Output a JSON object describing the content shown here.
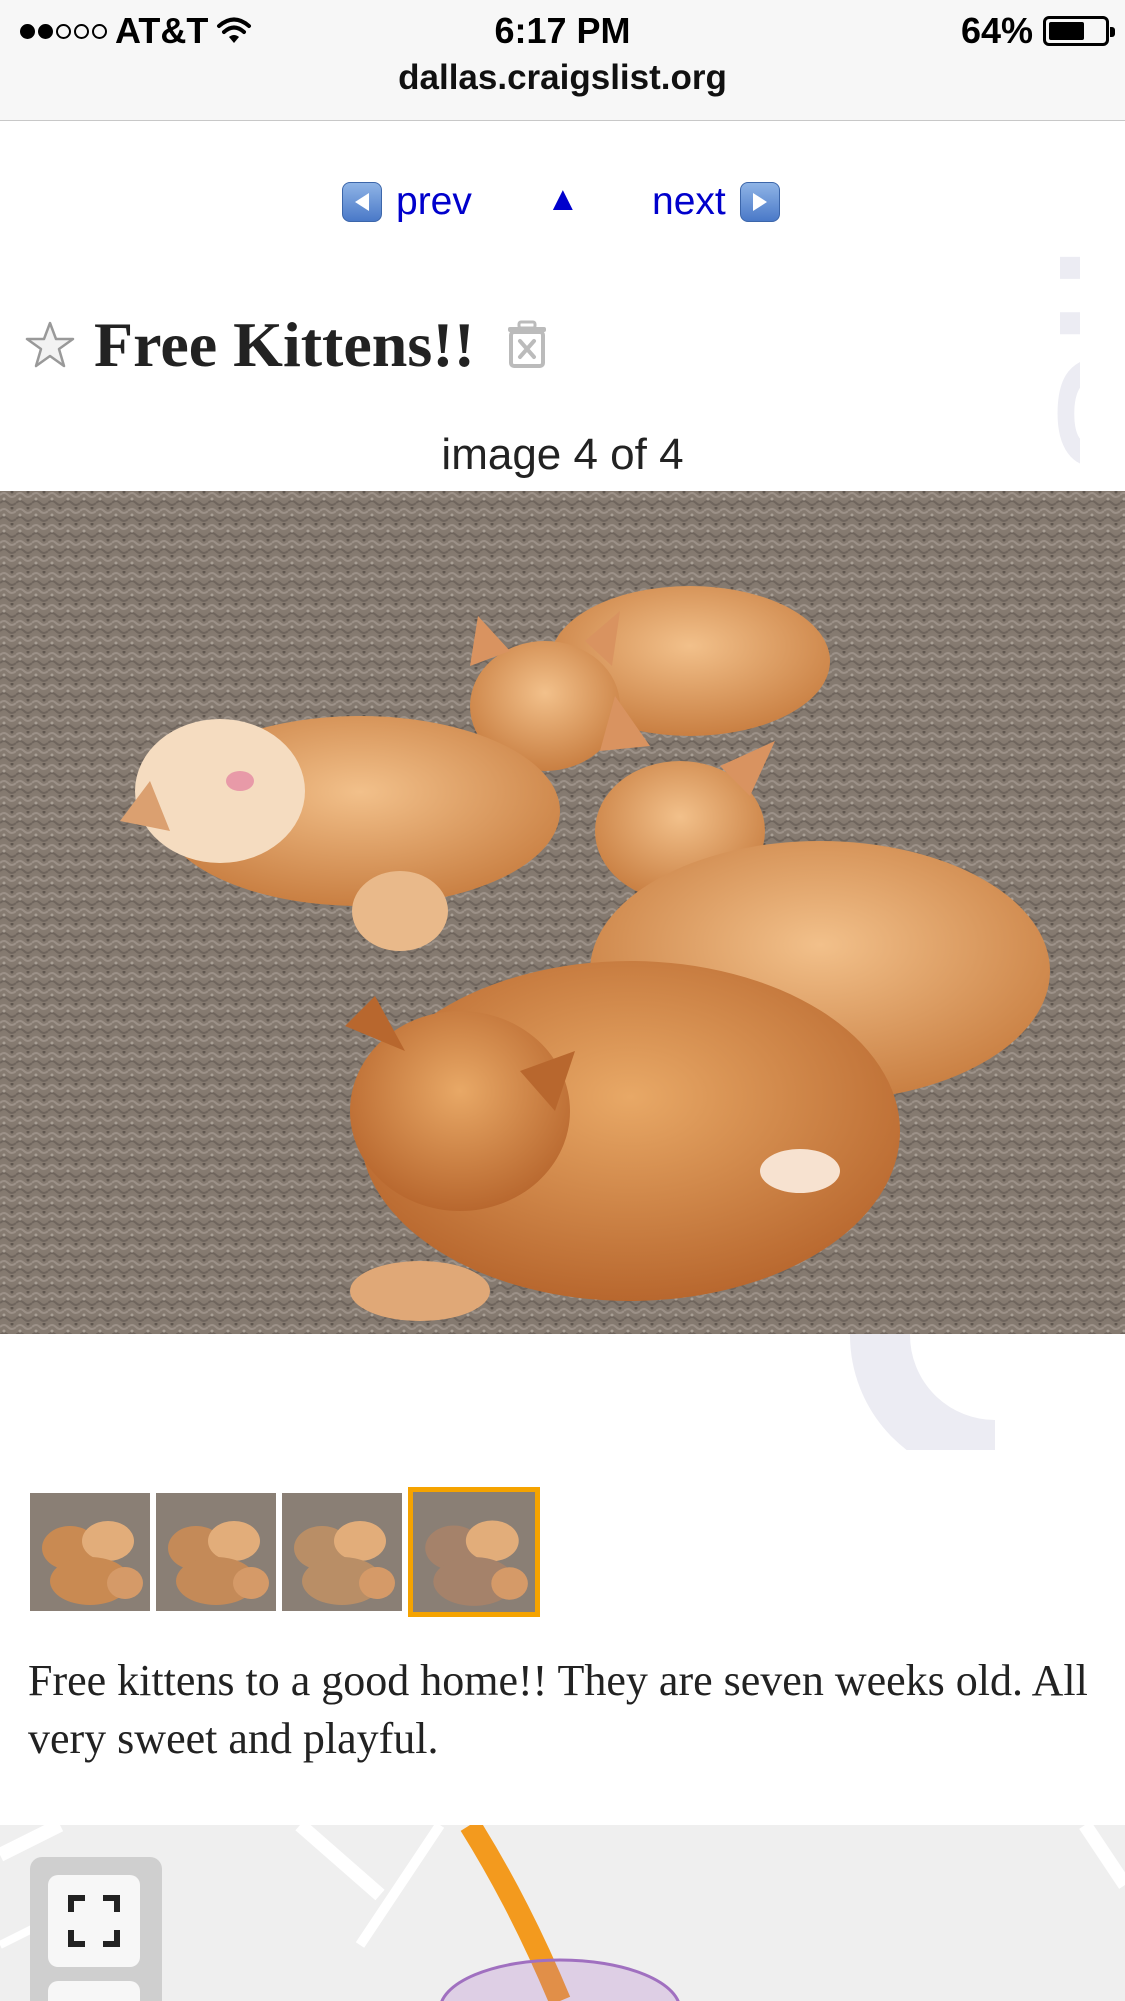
{
  "status_bar": {
    "carrier": "AT&T",
    "signal_bars_filled": 2,
    "signal_bars_total": 5,
    "time": "6:17 PM",
    "battery_percent_label": "64%",
    "battery_level": 0.64,
    "url": "dallas.craigslist.org"
  },
  "watermark": {
    "text": "list"
  },
  "nav": {
    "prev_label": "prev",
    "up_label": "▲",
    "next_label": "next"
  },
  "posting": {
    "title": "Free Kittens!!",
    "image_counter": "image 4 of 4",
    "selected_thumb_index": 3,
    "thumb_count": 4,
    "description": "Free kittens to a good home!! They are seven weeks old. All very sweet and playful."
  },
  "colors": {
    "link": "#0000cc",
    "selected_thumb_border": "#f5a300",
    "map_route": "#f39a1e"
  },
  "icons": [
    "star-icon",
    "delete-icon",
    "left-arrow-icon",
    "right-arrow-icon",
    "fullscreen-icon",
    "wifi-icon",
    "battery-icon"
  ]
}
